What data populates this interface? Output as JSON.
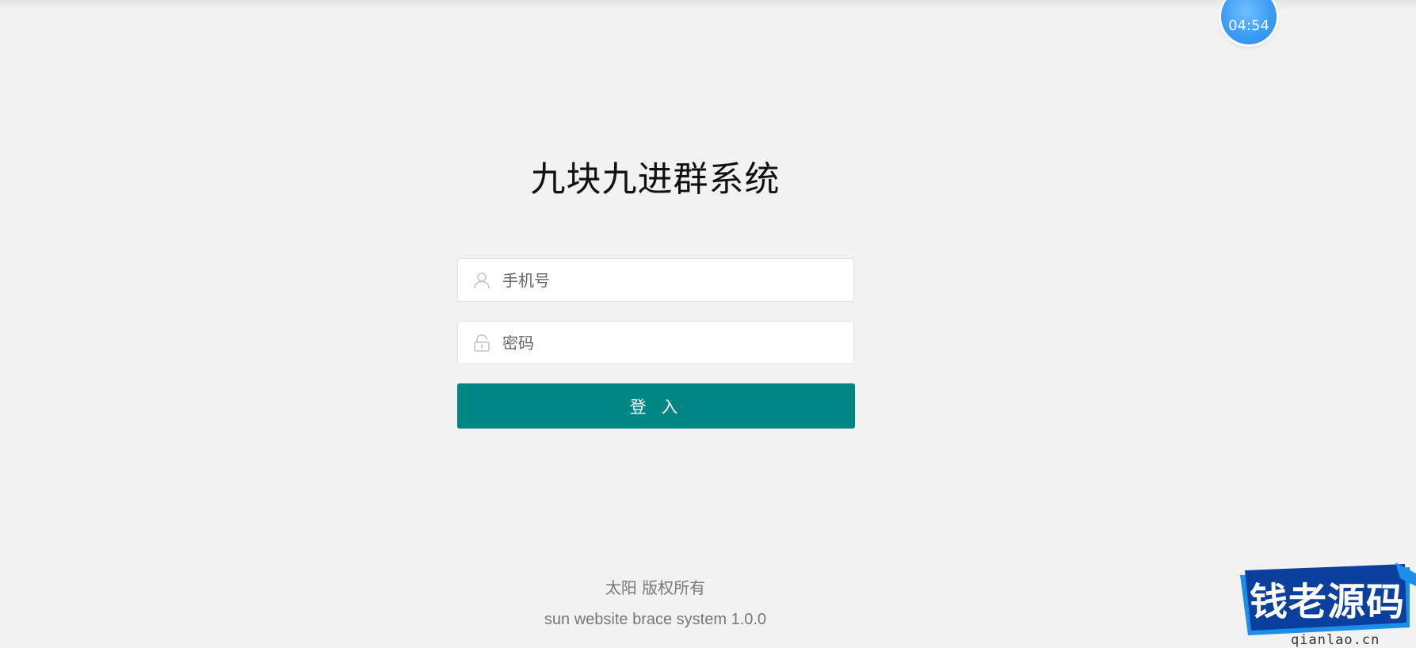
{
  "timer": {
    "text": "04:54"
  },
  "login": {
    "title": "九块九进群系统",
    "phone_placeholder": "手机号",
    "password_placeholder": "密码",
    "submit_label": "登 入"
  },
  "footer": {
    "copyright": "太阳 版权所有",
    "version": "sun website brace system 1.0.0"
  },
  "watermark": {
    "text": "钱老源码",
    "url": "qianlao.cn"
  },
  "icons": {
    "phone_field": "user-icon",
    "password_field": "lock-icon"
  },
  "colors": {
    "background": "#f2f2f2",
    "primary_button": "#008685",
    "timer_blue": "#3c9df5",
    "watermark_blue": "#1565c0"
  }
}
